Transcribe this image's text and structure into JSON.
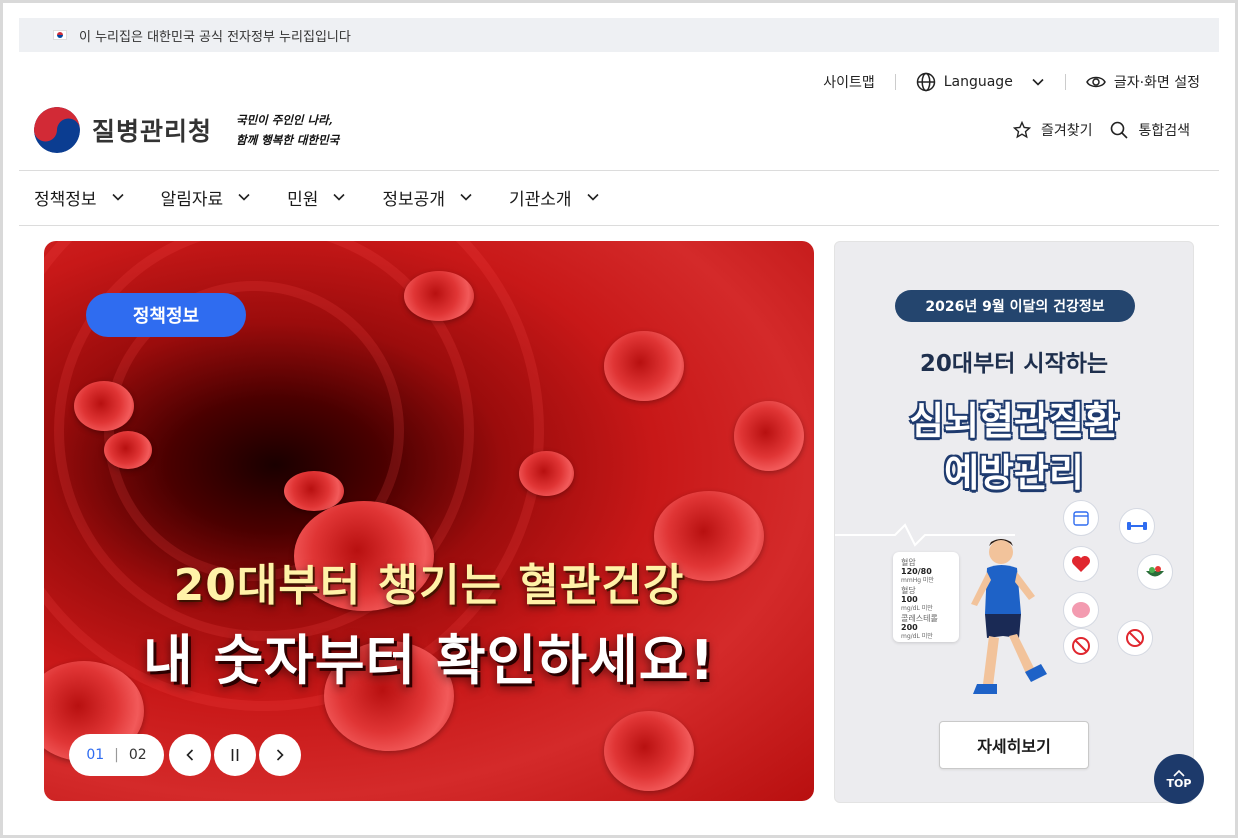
{
  "gov_banner": {
    "text": "이 누리집은 대한민국 공식 전자정부 누리집입니다"
  },
  "utility": {
    "sitemap": "사이트맵",
    "language": "Language",
    "display_settings": "글자·화면 설정"
  },
  "header": {
    "logo_text": "질병관리청",
    "slogan_line1": "국민이 주인인 나라,",
    "slogan_line2": "함께 행복한 대한민국",
    "favorites": "즐겨찾기",
    "search": "통합검색"
  },
  "nav": {
    "items": [
      {
        "label": "정책정보"
      },
      {
        "label": "알림자료"
      },
      {
        "label": "민원"
      },
      {
        "label": "정보공개"
      },
      {
        "label": "기관소개"
      }
    ]
  },
  "hero": {
    "badge": "정책정보",
    "line1": "20대부터 챙기는 혈관건강",
    "line2": "내 숫자부터 확인하세요!",
    "current_slide": "01",
    "total_slides": "02"
  },
  "side_banner": {
    "pill": "2026년 9월 이달의 건강정보",
    "subtitle": "20대부터 시작하는",
    "title_line1": "심뇌혈관질환",
    "title_line2": "예방관리",
    "stats": [
      {
        "label": "혈압",
        "value": "120/80",
        "unit": "mmHg 미만"
      },
      {
        "label": "혈당",
        "value": "100",
        "unit": "mg/dL 미만"
      },
      {
        "label": "콜레스테롤",
        "value": "200",
        "unit": "mg/dL 미만"
      }
    ],
    "more_button": "자세히보기"
  },
  "top_button": {
    "label": "TOP"
  },
  "colors": {
    "accent_blue": "#2f6cf0",
    "navy": "#1d3a6b",
    "hero_red": "#c81818"
  }
}
